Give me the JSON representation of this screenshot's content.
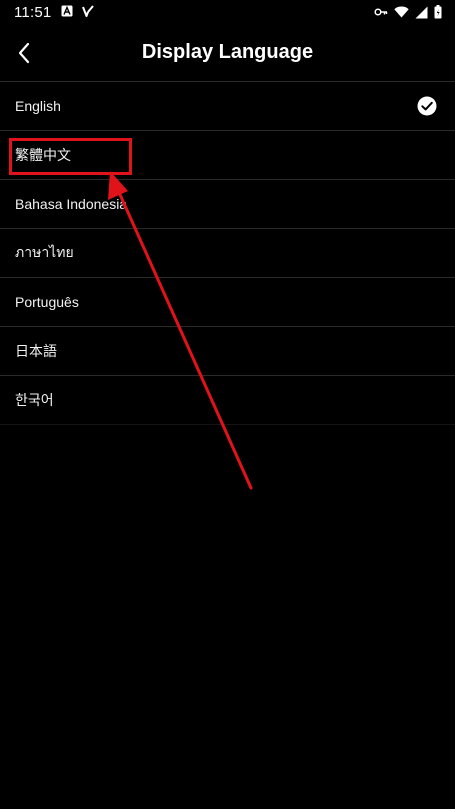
{
  "status_bar": {
    "time": "11:51"
  },
  "header": {
    "title": "Display Language"
  },
  "languages": [
    {
      "label": "English",
      "selected": true
    },
    {
      "label": "繁體中文",
      "selected": false
    },
    {
      "label": "Bahasa Indonesia",
      "selected": false
    },
    {
      "label": "ภาษาไทย",
      "selected": false
    },
    {
      "label": "Português",
      "selected": false
    },
    {
      "label": "日本語",
      "selected": false
    },
    {
      "label": "한국어",
      "selected": false
    }
  ],
  "icons": {
    "back": "chevron-left-icon",
    "selected": "check-circle-icon"
  },
  "colors": {
    "background": "#000000",
    "divider": "#2a2a2a",
    "annotation": "#e0121a"
  }
}
